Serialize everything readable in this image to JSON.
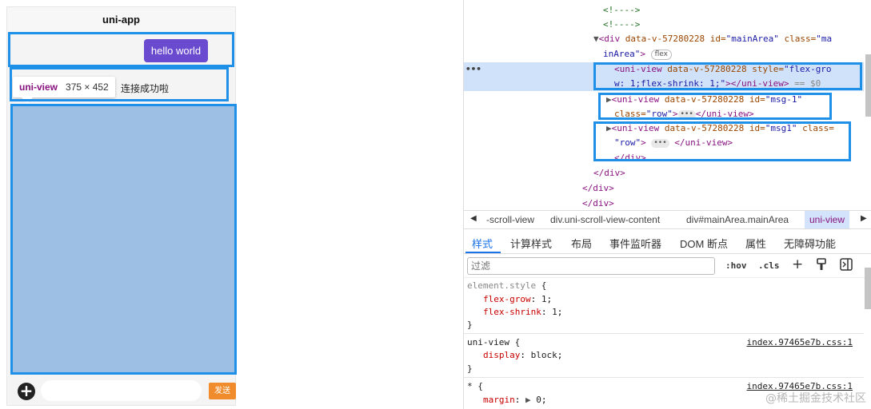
{
  "phone": {
    "title": "uni-app",
    "hello_button": "hello world",
    "tooltip_tag": "uni-view",
    "tooltip_size": "375 × 452",
    "message_text": "连接成功啦",
    "send_button": "发送",
    "plus_symbol": "+",
    "highlight_color": "#9dbfe3",
    "box_color": "#1e90e8"
  },
  "devtools": {
    "elements": {
      "comment1": "<!---->",
      "comment2": "<!---->",
      "main_div_tag": "<div",
      "main_div_attr1": "data-v-57280228",
      "main_div_id_attr": "id=",
      "main_div_id_val": "\"mainArea\"",
      "main_div_class_attr": "class=",
      "main_div_class_val1": "\"ma",
      "main_div_class_val2": "inArea\"",
      "flex_badge": "flex",
      "sel_line1_tag": "<uni-view",
      "sel_line1_attr": "data-v-57280228",
      "sel_line1_style_attr": "style=",
      "sel_line1_style_val1": "\"flex-gro",
      "sel_line2_val": "w: 1;flex-shrink: 1;\"",
      "sel_line2_close": "></uni-view>",
      "sel_line2_ref": "== $0",
      "msg1_tag": "<uni-view",
      "msg1_attr": "data-v-57280228",
      "msg1_id_attr": "id=",
      "msg1_id_val": "\"msg-1\"",
      "msg1_class_attr": "class=",
      "msg1_class_val": "\"row\"",
      "msg1_close": "</uni-view>",
      "msg2_tag": "<uni-view",
      "msg2_attr": "data-v-57280228",
      "msg2_id_attr": "id=",
      "msg2_id_val": "\"msg1\"",
      "msg2_class_attr": "class=",
      "msg2_class_val": "\"row\"",
      "msg2_close": "</uni-view>",
      "close_div1": "</div>",
      "close_div2": "</div>",
      "close_div3": "</div>",
      "close_div4": "</div>",
      "ellipsis_badge": "•••",
      "dots": "•••"
    },
    "breadcrumb": [
      "-scroll-view",
      "div.uni-scroll-view-content",
      "div#mainArea.mainArea",
      "uni-view"
    ],
    "tabs": [
      "样式",
      "计算样式",
      "布局",
      "事件监听器",
      "DOM 断点",
      "属性",
      "无障碍功能"
    ],
    "filter": {
      "placeholder": "过滤",
      "hov": ":hov",
      "cls": ".cls",
      "plus": "+"
    },
    "styles": {
      "rule1_selector": "element.style",
      "rule1_props": [
        {
          "name": "flex-grow",
          "value": "1"
        },
        {
          "name": "flex-shrink",
          "value": "1"
        }
      ],
      "rule2_selector": "uni-view",
      "rule2_source": "index.97465e7b.css:1",
      "rule2_props": [
        {
          "name": "display",
          "value": "block"
        }
      ],
      "rule3_selector": "*",
      "rule3_source": "index.97465e7b.css:1",
      "rule3_props": [
        {
          "name": "margin",
          "value": "0"
        }
      ]
    },
    "watermark": "@稀土掘金技术社区"
  }
}
